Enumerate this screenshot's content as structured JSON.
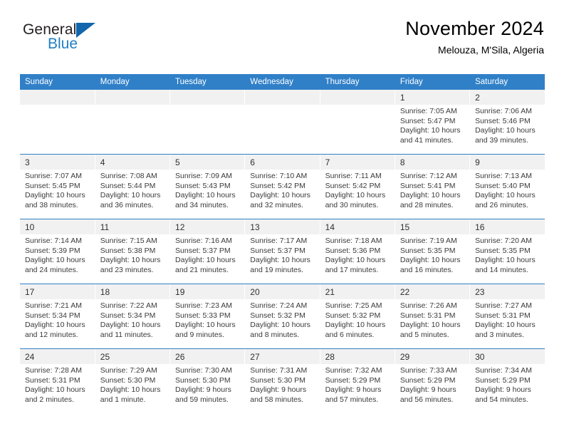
{
  "logo": {
    "word_one": "General",
    "word_two": "Blue",
    "triangle_color": "#1266ad"
  },
  "header": {
    "title": "November 2024",
    "subtitle": "Melouza, M'Sila, Algeria"
  },
  "theme": {
    "header_blue": "#3080c8",
    "daynum_band": "#f1f1f1",
    "text": "#3a3a3a"
  },
  "calendar": {
    "weekday_headers": [
      "Sunday",
      "Monday",
      "Tuesday",
      "Wednesday",
      "Thursday",
      "Friday",
      "Saturday"
    ],
    "weeks": [
      [
        {
          "day": "",
          "lines": []
        },
        {
          "day": "",
          "lines": []
        },
        {
          "day": "",
          "lines": []
        },
        {
          "day": "",
          "lines": []
        },
        {
          "day": "",
          "lines": []
        },
        {
          "day": "1",
          "lines": [
            "Sunrise: 7:05 AM",
            "Sunset: 5:47 PM",
            "Daylight: 10 hours",
            "and 41 minutes."
          ]
        },
        {
          "day": "2",
          "lines": [
            "Sunrise: 7:06 AM",
            "Sunset: 5:46 PM",
            "Daylight: 10 hours",
            "and 39 minutes."
          ]
        }
      ],
      [
        {
          "day": "3",
          "lines": [
            "Sunrise: 7:07 AM",
            "Sunset: 5:45 PM",
            "Daylight: 10 hours",
            "and 38 minutes."
          ]
        },
        {
          "day": "4",
          "lines": [
            "Sunrise: 7:08 AM",
            "Sunset: 5:44 PM",
            "Daylight: 10 hours",
            "and 36 minutes."
          ]
        },
        {
          "day": "5",
          "lines": [
            "Sunrise: 7:09 AM",
            "Sunset: 5:43 PM",
            "Daylight: 10 hours",
            "and 34 minutes."
          ]
        },
        {
          "day": "6",
          "lines": [
            "Sunrise: 7:10 AM",
            "Sunset: 5:42 PM",
            "Daylight: 10 hours",
            "and 32 minutes."
          ]
        },
        {
          "day": "7",
          "lines": [
            "Sunrise: 7:11 AM",
            "Sunset: 5:42 PM",
            "Daylight: 10 hours",
            "and 30 minutes."
          ]
        },
        {
          "day": "8",
          "lines": [
            "Sunrise: 7:12 AM",
            "Sunset: 5:41 PM",
            "Daylight: 10 hours",
            "and 28 minutes."
          ]
        },
        {
          "day": "9",
          "lines": [
            "Sunrise: 7:13 AM",
            "Sunset: 5:40 PM",
            "Daylight: 10 hours",
            "and 26 minutes."
          ]
        }
      ],
      [
        {
          "day": "10",
          "lines": [
            "Sunrise: 7:14 AM",
            "Sunset: 5:39 PM",
            "Daylight: 10 hours",
            "and 24 minutes."
          ]
        },
        {
          "day": "11",
          "lines": [
            "Sunrise: 7:15 AM",
            "Sunset: 5:38 PM",
            "Daylight: 10 hours",
            "and 23 minutes."
          ]
        },
        {
          "day": "12",
          "lines": [
            "Sunrise: 7:16 AM",
            "Sunset: 5:37 PM",
            "Daylight: 10 hours",
            "and 21 minutes."
          ]
        },
        {
          "day": "13",
          "lines": [
            "Sunrise: 7:17 AM",
            "Sunset: 5:37 PM",
            "Daylight: 10 hours",
            "and 19 minutes."
          ]
        },
        {
          "day": "14",
          "lines": [
            "Sunrise: 7:18 AM",
            "Sunset: 5:36 PM",
            "Daylight: 10 hours",
            "and 17 minutes."
          ]
        },
        {
          "day": "15",
          "lines": [
            "Sunrise: 7:19 AM",
            "Sunset: 5:35 PM",
            "Daylight: 10 hours",
            "and 16 minutes."
          ]
        },
        {
          "day": "16",
          "lines": [
            "Sunrise: 7:20 AM",
            "Sunset: 5:35 PM",
            "Daylight: 10 hours",
            "and 14 minutes."
          ]
        }
      ],
      [
        {
          "day": "17",
          "lines": [
            "Sunrise: 7:21 AM",
            "Sunset: 5:34 PM",
            "Daylight: 10 hours",
            "and 12 minutes."
          ]
        },
        {
          "day": "18",
          "lines": [
            "Sunrise: 7:22 AM",
            "Sunset: 5:34 PM",
            "Daylight: 10 hours",
            "and 11 minutes."
          ]
        },
        {
          "day": "19",
          "lines": [
            "Sunrise: 7:23 AM",
            "Sunset: 5:33 PM",
            "Daylight: 10 hours",
            "and 9 minutes."
          ]
        },
        {
          "day": "20",
          "lines": [
            "Sunrise: 7:24 AM",
            "Sunset: 5:32 PM",
            "Daylight: 10 hours",
            "and 8 minutes."
          ]
        },
        {
          "day": "21",
          "lines": [
            "Sunrise: 7:25 AM",
            "Sunset: 5:32 PM",
            "Daylight: 10 hours",
            "and 6 minutes."
          ]
        },
        {
          "day": "22",
          "lines": [
            "Sunrise: 7:26 AM",
            "Sunset: 5:31 PM",
            "Daylight: 10 hours",
            "and 5 minutes."
          ]
        },
        {
          "day": "23",
          "lines": [
            "Sunrise: 7:27 AM",
            "Sunset: 5:31 PM",
            "Daylight: 10 hours",
            "and 3 minutes."
          ]
        }
      ],
      [
        {
          "day": "24",
          "lines": [
            "Sunrise: 7:28 AM",
            "Sunset: 5:31 PM",
            "Daylight: 10 hours",
            "and 2 minutes."
          ]
        },
        {
          "day": "25",
          "lines": [
            "Sunrise: 7:29 AM",
            "Sunset: 5:30 PM",
            "Daylight: 10 hours",
            "and 1 minute."
          ]
        },
        {
          "day": "26",
          "lines": [
            "Sunrise: 7:30 AM",
            "Sunset: 5:30 PM",
            "Daylight: 9 hours",
            "and 59 minutes."
          ]
        },
        {
          "day": "27",
          "lines": [
            "Sunrise: 7:31 AM",
            "Sunset: 5:30 PM",
            "Daylight: 9 hours",
            "and 58 minutes."
          ]
        },
        {
          "day": "28",
          "lines": [
            "Sunrise: 7:32 AM",
            "Sunset: 5:29 PM",
            "Daylight: 9 hours",
            "and 57 minutes."
          ]
        },
        {
          "day": "29",
          "lines": [
            "Sunrise: 7:33 AM",
            "Sunset: 5:29 PM",
            "Daylight: 9 hours",
            "and 56 minutes."
          ]
        },
        {
          "day": "30",
          "lines": [
            "Sunrise: 7:34 AM",
            "Sunset: 5:29 PM",
            "Daylight: 9 hours",
            "and 54 minutes."
          ]
        }
      ]
    ]
  }
}
